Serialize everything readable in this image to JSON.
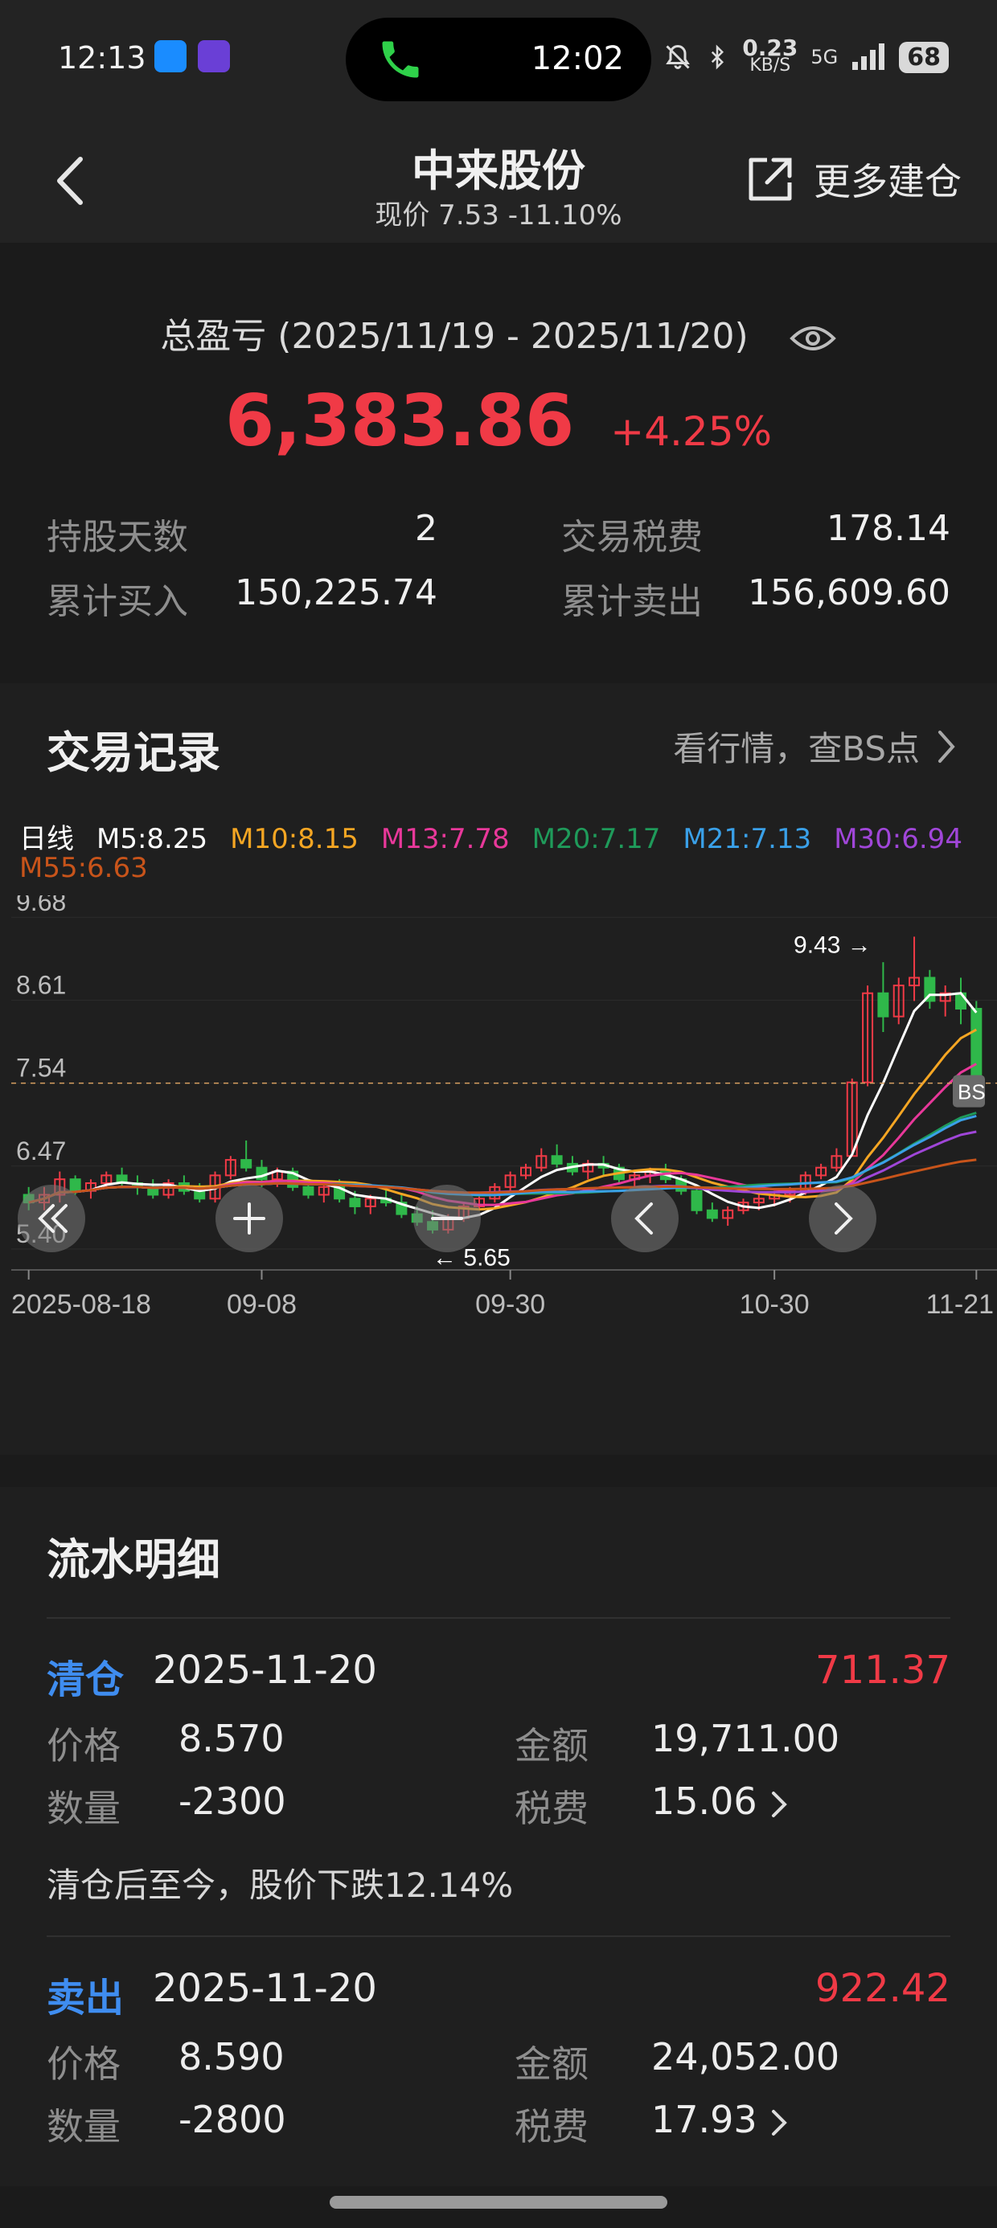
{
  "status_bar": {
    "time": "12:13",
    "call_time": "12:02",
    "net_speed": "0.23",
    "net_unit": "KB/S",
    "net_type": "5G",
    "battery": "68"
  },
  "header": {
    "title": "中来股份",
    "subtitle": "现价 7.53 -11.10%",
    "more_label": "更多建仓"
  },
  "summary": {
    "pl_label": "总盈亏 (2025/11/19 - 2025/11/20)",
    "pl_amount": "6,383.86",
    "pl_pct": "+4.25%",
    "hold_days_label": "持股天数",
    "hold_days": "2",
    "tax_label": "交易税费",
    "tax": "178.14",
    "buy_total_label": "累计买入",
    "buy_total": "150,225.74",
    "sell_total_label": "累计卖出",
    "sell_total": "156,609.60"
  },
  "trade": {
    "title": "交易记录",
    "link": "看行情，查BS点",
    "period": "日线",
    "ma": [
      {
        "label": "M5:8.25",
        "color": "#ffffff"
      },
      {
        "label": "M10:8.15",
        "color": "#f5a623"
      },
      {
        "label": "M13:7.78",
        "color": "#e8389a"
      },
      {
        "label": "M20:7.17",
        "color": "#1f9a5a"
      },
      {
        "label": "M21:7.13",
        "color": "#3aa0e8"
      },
      {
        "label": "M30:6.94",
        "color": "#a046d8"
      },
      {
        "label": "M55:6.63",
        "color": "#c8541a"
      }
    ]
  },
  "chart_data": {
    "type": "candlestick",
    "y_ticks": [
      "9.68",
      "8.61",
      "7.54",
      "6.47",
      "5.40"
    ],
    "ylim": [
      5.4,
      9.9
    ],
    "current_price_line": 7.54,
    "x_ticks": [
      "2025-08-18",
      "09-08",
      "09-30",
      "10-30",
      "11-21"
    ],
    "max_label": "9.43",
    "min_label": "5.65",
    "bs_marker": "BS",
    "candles": [
      [
        6.1,
        6.2,
        5.9,
        6.0
      ],
      [
        6.0,
        6.2,
        5.9,
        6.1
      ],
      [
        6.1,
        6.4,
        6.0,
        6.3
      ],
      [
        6.3,
        6.35,
        6.1,
        6.15
      ],
      [
        6.15,
        6.3,
        6.05,
        6.25
      ],
      [
        6.25,
        6.4,
        6.2,
        6.35
      ],
      [
        6.35,
        6.45,
        6.2,
        6.25
      ],
      [
        6.25,
        6.35,
        6.1,
        6.2
      ],
      [
        6.2,
        6.3,
        6.05,
        6.1
      ],
      [
        6.1,
        6.3,
        6.05,
        6.25
      ],
      [
        6.25,
        6.35,
        6.1,
        6.15
      ],
      [
        6.15,
        6.25,
        6.0,
        6.05
      ],
      [
        6.05,
        6.4,
        6.0,
        6.35
      ],
      [
        6.35,
        6.6,
        6.3,
        6.55
      ],
      [
        6.55,
        6.8,
        6.4,
        6.45
      ],
      [
        6.45,
        6.55,
        6.2,
        6.3
      ],
      [
        6.3,
        6.45,
        6.2,
        6.4
      ],
      [
        6.4,
        6.45,
        6.15,
        6.2
      ],
      [
        6.2,
        6.3,
        6.05,
        6.1
      ],
      [
        6.1,
        6.25,
        6.0,
        6.2
      ],
      [
        6.2,
        6.3,
        6.0,
        6.05
      ],
      [
        6.05,
        6.15,
        5.85,
        5.95
      ],
      [
        5.95,
        6.1,
        5.85,
        6.05
      ],
      [
        6.05,
        6.2,
        5.95,
        6.0
      ],
      [
        6.0,
        6.1,
        5.8,
        5.85
      ],
      [
        5.85,
        5.95,
        5.7,
        5.75
      ],
      [
        5.75,
        5.9,
        5.6,
        5.65
      ],
      [
        5.65,
        5.85,
        5.6,
        5.8
      ],
      [
        5.8,
        6.0,
        5.75,
        5.95
      ],
      [
        5.95,
        6.1,
        5.9,
        6.05
      ],
      [
        6.05,
        6.25,
        6.0,
        6.2
      ],
      [
        6.2,
        6.4,
        6.15,
        6.35
      ],
      [
        6.35,
        6.5,
        6.3,
        6.45
      ],
      [
        6.45,
        6.7,
        6.4,
        6.6
      ],
      [
        6.6,
        6.75,
        6.45,
        6.5
      ],
      [
        6.5,
        6.6,
        6.35,
        6.4
      ],
      [
        6.4,
        6.55,
        6.3,
        6.5
      ],
      [
        6.5,
        6.6,
        6.35,
        6.45
      ],
      [
        6.45,
        6.5,
        6.25,
        6.3
      ],
      [
        6.3,
        6.4,
        6.2,
        6.35
      ],
      [
        6.35,
        6.45,
        6.25,
        6.4
      ],
      [
        6.4,
        6.5,
        6.25,
        6.3
      ],
      [
        6.3,
        6.35,
        6.1,
        6.15
      ],
      [
        6.15,
        6.2,
        5.85,
        5.9
      ],
      [
        5.9,
        6.0,
        5.75,
        5.8
      ],
      [
        5.8,
        5.95,
        5.7,
        5.9
      ],
      [
        5.9,
        6.05,
        5.85,
        6.0
      ],
      [
        6.0,
        6.1,
        5.9,
        6.05
      ],
      [
        6.05,
        6.15,
        5.95,
        6.1
      ],
      [
        6.1,
        6.2,
        6.0,
        6.15
      ],
      [
        6.15,
        6.4,
        6.1,
        6.35
      ],
      [
        6.35,
        6.5,
        6.3,
        6.45
      ],
      [
        6.45,
        6.7,
        6.4,
        6.6
      ],
      [
        6.6,
        7.6,
        6.6,
        7.55
      ],
      [
        7.55,
        8.8,
        7.5,
        8.7
      ],
      [
        8.7,
        9.1,
        8.2,
        8.4
      ],
      [
        8.4,
        8.9,
        8.3,
        8.8
      ],
      [
        8.8,
        9.43,
        8.6,
        8.9
      ],
      [
        8.9,
        9.0,
        8.5,
        8.6
      ],
      [
        8.6,
        8.8,
        8.4,
        8.7
      ],
      [
        8.7,
        8.9,
        8.3,
        8.5
      ],
      [
        8.5,
        8.6,
        7.5,
        7.55
      ]
    ]
  },
  "flow": {
    "title": "流水明细",
    "records": [
      {
        "type": "清仓",
        "date": "2025-11-20",
        "profit": "711.37",
        "price_label": "价格",
        "price": "8.570",
        "amount_label": "金额",
        "amount": "19,711.00",
        "qty_label": "数量",
        "qty": "-2300",
        "fee_label": "税费",
        "fee": "15.06",
        "note": "清仓后至今，股价下跌12.14%"
      },
      {
        "type": "卖出",
        "date": "2025-11-20",
        "profit": "922.42",
        "price_label": "价格",
        "price": "8.590",
        "amount_label": "金额",
        "amount": "24,052.00",
        "qty_label": "数量",
        "qty": "-2800",
        "fee_label": "税费",
        "fee": "17.93"
      }
    ]
  },
  "colors": {
    "up": "#f03a46",
    "down": "#2fb84a",
    "accent_blue": "#3f8df0"
  }
}
